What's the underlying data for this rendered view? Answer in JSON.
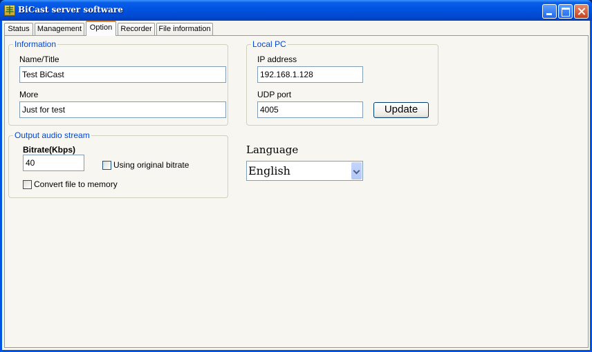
{
  "window": {
    "title": "BiCast server software",
    "app_icon_glyph": "丰",
    "controls": [
      "minimize-icon",
      "maximize-icon",
      "close-icon"
    ]
  },
  "tabs": [
    {
      "label": "Status",
      "active": false
    },
    {
      "label": "Management",
      "active": false
    },
    {
      "label": "Option",
      "active": true
    },
    {
      "label": "Recorder",
      "active": false
    },
    {
      "label": "File information",
      "active": false
    }
  ],
  "information": {
    "legend": "Information",
    "name_label": "Name/Title",
    "name_value": "Test BiCast",
    "more_label": "More",
    "more_value": "Just for test"
  },
  "local_pc": {
    "legend": "Local PC",
    "ip_label": "IP address",
    "ip_value": "192.168.1.128",
    "udp_label": "UDP port",
    "udp_value": "4005",
    "update_button": "Update"
  },
  "output_audio": {
    "legend": "Output audio stream",
    "bitrate_label": "Bitrate(Kbps)",
    "bitrate_value": "40",
    "original_bitrate_label": "Using original bitrate",
    "original_bitrate_checked": false,
    "convert_memory_label": "Convert file to memory",
    "convert_memory_checked": false
  },
  "language": {
    "label": "Language",
    "selected": "English"
  },
  "colors": {
    "titlebar": "#0054e3",
    "legend_text": "#0046d5",
    "active_tab_accent": "#e68b2c",
    "panel_background": "#f7f6f1"
  }
}
